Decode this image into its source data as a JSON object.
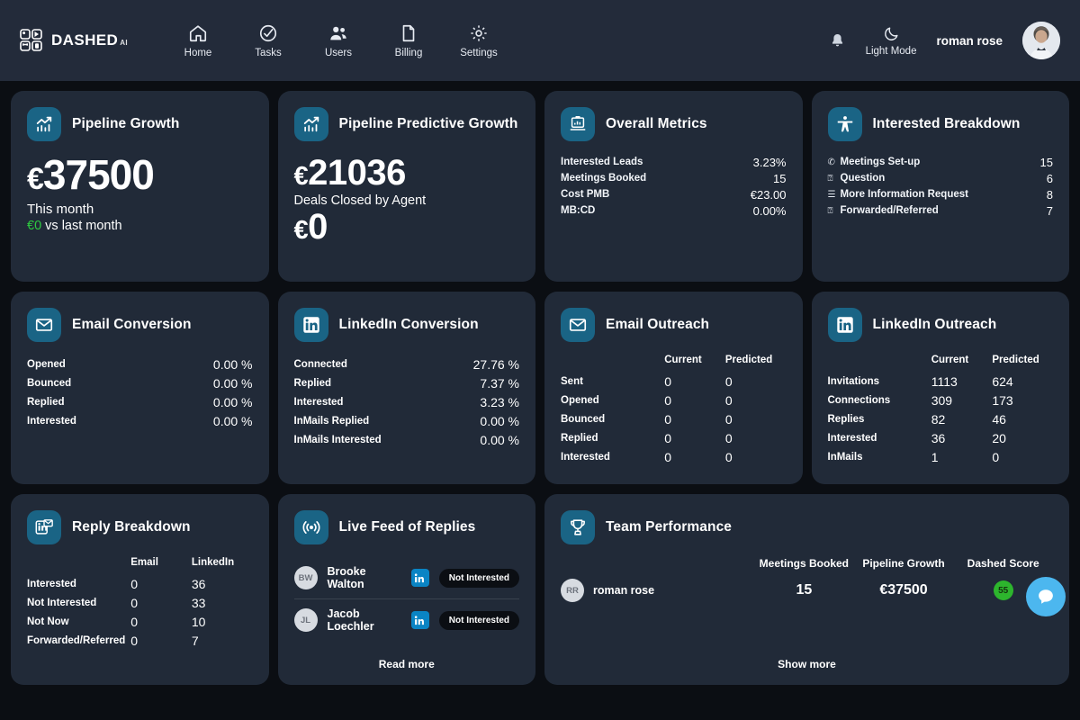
{
  "header": {
    "logo_text": "DASHED",
    "logo_suffix": "AI",
    "nav": [
      {
        "label": "Home",
        "icon": "home-icon"
      },
      {
        "label": "Tasks",
        "icon": "check-circle-icon"
      },
      {
        "label": "Users",
        "icon": "users-icon"
      },
      {
        "label": "Billing",
        "icon": "document-icon"
      },
      {
        "label": "Settings",
        "icon": "gear-icon"
      }
    ],
    "bell_icon": "bell-icon",
    "mode_icon": "moon-icon",
    "mode_label": "Light Mode",
    "user_name": "roman rose",
    "avatar": "user-photo"
  },
  "cards": {
    "pipeline_growth": {
      "title": "Pipeline Growth",
      "icon": "chart-up-icon",
      "currency": "€",
      "value": "37500",
      "sub": "This month",
      "delta": "€0",
      "delta_suffix": " vs last month"
    },
    "pipeline_predictive": {
      "title": "Pipeline Predictive Growth",
      "icon": "chart-up-icon",
      "currency": "€",
      "value": "21036",
      "sub": "Deals Closed by Agent",
      "second_currency": "€",
      "second_value": "0"
    },
    "overall_metrics": {
      "title": "Overall Metrics",
      "icon": "laptop-chart-icon",
      "rows": [
        {
          "label": "Interested Leads",
          "value": "3.23%"
        },
        {
          "label": "Meetings Booked",
          "value": "15"
        },
        {
          "label": "Cost PMB",
          "value": "€23.00"
        },
        {
          "label": "MB:CD",
          "value": "0.00%"
        }
      ]
    },
    "interested_breakdown": {
      "title": "Interested Breakdown",
      "icon": "accessibility-person-icon",
      "rows": [
        {
          "icon": "phone-icon",
          "glyph": "✆",
          "label": "Meetings Set-up",
          "value": "15"
        },
        {
          "icon": "question-icon",
          "glyph": "⍰",
          "label": "Question",
          "value": "6"
        },
        {
          "icon": "document-icon",
          "glyph": "☰",
          "label": "More Information Request",
          "value": "8"
        },
        {
          "icon": "question-icon",
          "glyph": "⍰",
          "label": "Forwarded/Referred",
          "value": "7"
        }
      ]
    },
    "email_conversion": {
      "title": "Email Conversion",
      "icon": "envelope-icon",
      "rows": [
        {
          "label": "Opened",
          "value": "0.00 %"
        },
        {
          "label": "Bounced",
          "value": "0.00 %"
        },
        {
          "label": "Replied",
          "value": "0.00 %"
        },
        {
          "label": "Interested",
          "value": "0.00 %"
        }
      ]
    },
    "linkedin_conversion": {
      "title": "LinkedIn Conversion",
      "icon": "linkedin-icon",
      "rows": [
        {
          "label": "Connected",
          "value": "27.76 %"
        },
        {
          "label": "Replied",
          "value": "7.37 %"
        },
        {
          "label": "Interested",
          "value": "3.23 %"
        },
        {
          "label": "InMails Replied",
          "value": "0.00 %"
        },
        {
          "label": "InMails Interested",
          "value": "0.00 %"
        }
      ]
    },
    "email_outreach": {
      "title": "Email Outreach",
      "icon": "envelope-icon",
      "columns": [
        "Current",
        "Predicted"
      ],
      "rows": [
        {
          "label": "Sent",
          "current": "0",
          "predicted": "0"
        },
        {
          "label": "Opened",
          "current": "0",
          "predicted": "0"
        },
        {
          "label": "Bounced",
          "current": "0",
          "predicted": "0"
        },
        {
          "label": "Replied",
          "current": "0",
          "predicted": "0"
        },
        {
          "label": "Interested",
          "current": "0",
          "predicted": "0"
        }
      ]
    },
    "linkedin_outreach": {
      "title": "LinkedIn Outreach",
      "icon": "linkedin-icon",
      "columns": [
        "Current",
        "Predicted"
      ],
      "rows": [
        {
          "label": "Invitations",
          "current": "1113",
          "predicted": "624"
        },
        {
          "label": "Connections",
          "current": "309",
          "predicted": "173"
        },
        {
          "label": "Replies",
          "current": "82",
          "predicted": "46"
        },
        {
          "label": "Interested",
          "current": "36",
          "predicted": "20"
        },
        {
          "label": "InMails",
          "current": "1",
          "predicted": "0"
        }
      ]
    },
    "reply_breakdown": {
      "title": "Reply Breakdown",
      "icon": "linkedin-mail-icon",
      "columns": [
        "Email",
        "LinkedIn"
      ],
      "rows": [
        {
          "label": "Interested",
          "email": "0",
          "linkedin": "36"
        },
        {
          "label": "Not Interested",
          "email": "0",
          "linkedin": "33"
        },
        {
          "label": "Not Now",
          "email": "0",
          "linkedin": "10"
        },
        {
          "label": "Forwarded/Referred",
          "email": "0",
          "linkedin": "7"
        }
      ]
    },
    "live_feed": {
      "title": "Live Feed of Replies",
      "icon": "broadcast-icon",
      "rows": [
        {
          "initials": "BW",
          "name": "Brooke Walton",
          "channel": "linkedin-icon",
          "status": "Not Interested"
        },
        {
          "initials": "JL",
          "name": "Jacob Loechler",
          "channel": "linkedin-icon",
          "status": "Not Interested"
        }
      ],
      "link": "Read more"
    },
    "team_performance": {
      "title": "Team Performance",
      "icon": "trophy-icon",
      "columns": [
        "Meetings Booked",
        "Pipeline Growth",
        "Dashed Score"
      ],
      "rows": [
        {
          "initials": "RR",
          "name": "roman rose",
          "meetings_booked": "15",
          "pipeline_growth": "€37500",
          "dashed_score": "55"
        }
      ],
      "link": "Show more"
    }
  },
  "fab": {
    "icon": "chat-bubble-icon"
  },
  "colors": {
    "page_bg": "#0b0e13",
    "header_bg": "#232b3a",
    "card_bg": "#212a38",
    "tile": "#1a6485",
    "accent_green": "#2ecc40",
    "score_green": "#2db52d",
    "fab_blue": "#4cb7ef",
    "linkedin_blue": "#0a84c4"
  }
}
